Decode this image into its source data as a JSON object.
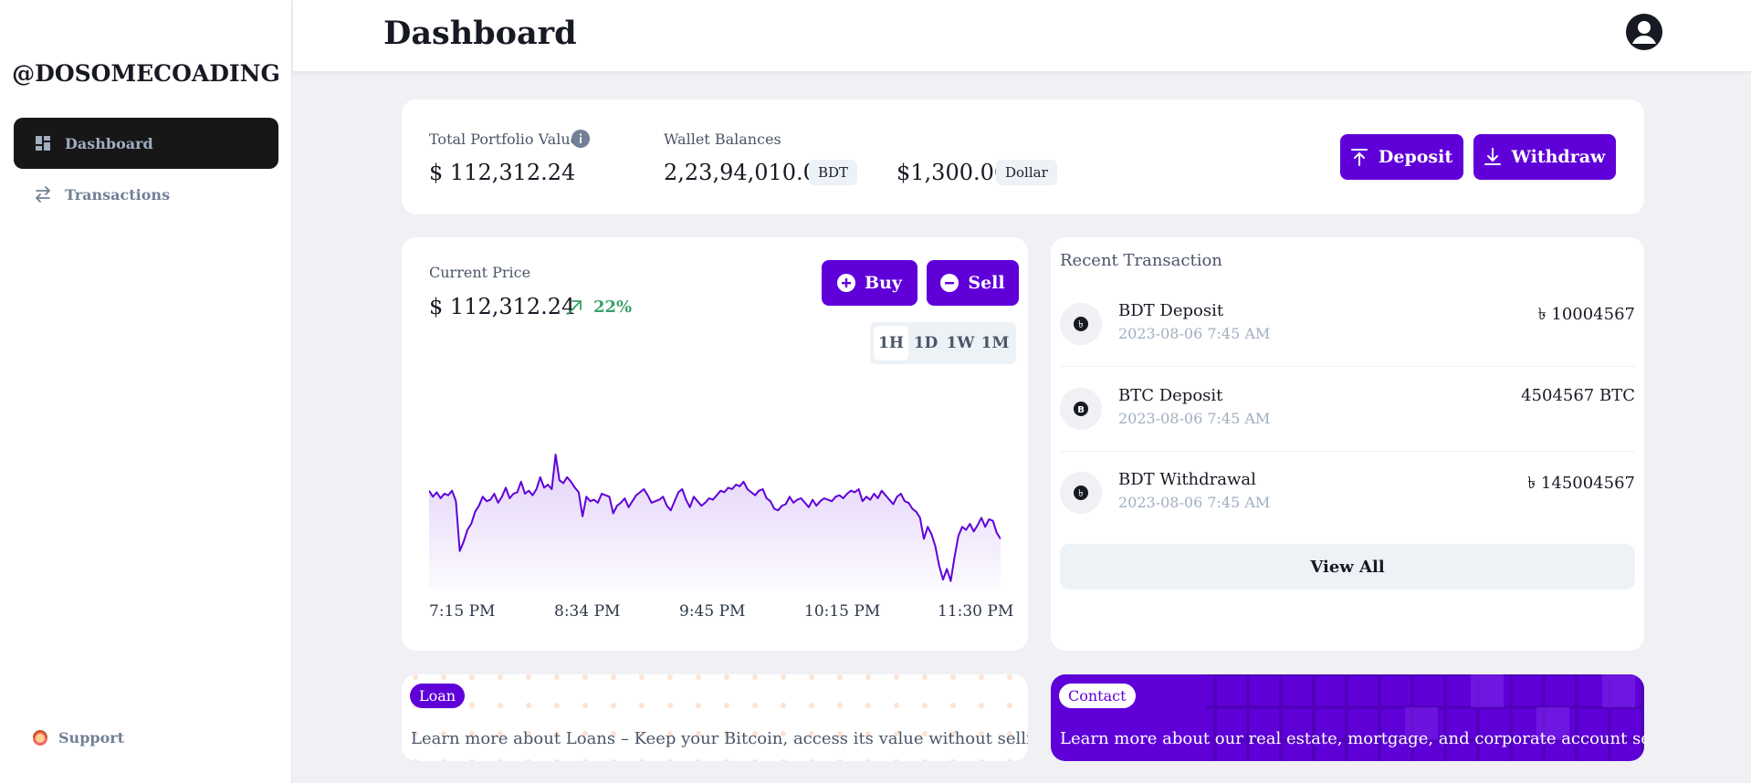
{
  "sidebar": {
    "brand": "@DOSOMECOADING",
    "items": [
      {
        "label": "Dashboard",
        "icon": "dashboard-icon",
        "active": true
      },
      {
        "label": "Transactions",
        "icon": "transfer-arrows-icon",
        "active": false
      }
    ],
    "support_label": "Support",
    "support_icon": "support-agent-icon"
  },
  "header": {
    "title": "Dashboard",
    "avatar_icon": "user-circle-icon"
  },
  "portfolio": {
    "total_label": "Total Portfolio Value",
    "total_value": "$ 112,312.24",
    "wallet_label": "Wallet Balances",
    "balances": [
      {
        "value": "2,23,94,010.00",
        "currency": "BDT"
      },
      {
        "value": "$1,300.00",
        "currency": "Dollar"
      }
    ],
    "deposit_label": "Deposit",
    "withdraw_label": "Withdraw"
  },
  "price": {
    "label": "Current Price",
    "value": "$ 112,312.24",
    "change": "22%",
    "buy_label": "Buy",
    "sell_label": "Sell",
    "ranges": [
      "1H",
      "1D",
      "1W",
      "1M"
    ],
    "active_range": "1H"
  },
  "chart_data": {
    "type": "area",
    "x_ticks": [
      "7:15 PM",
      "8:34 PM",
      "9:45 PM",
      "10:15 PM",
      "11:30 PM"
    ],
    "values": [
      62,
      58,
      61,
      57,
      60,
      59,
      62,
      55,
      22,
      28,
      36,
      40,
      48,
      52,
      58,
      55,
      56,
      60,
      54,
      58,
      64,
      57,
      60,
      61,
      68,
      60,
      62,
      59,
      63,
      71,
      64,
      66,
      63,
      86,
      69,
      67,
      71,
      68,
      64,
      61,
      45,
      58,
      55,
      56,
      54,
      60,
      59,
      58,
      47,
      52,
      54,
      57,
      51,
      55,
      59,
      61,
      63,
      59,
      54,
      55,
      56,
      58,
      52,
      49,
      55,
      61,
      63,
      56,
      51,
      58,
      55,
      52,
      54,
      57,
      56,
      59,
      62,
      61,
      64,
      63,
      66,
      65,
      68,
      63,
      61,
      59,
      62,
      63,
      57,
      55,
      50,
      49,
      52,
      53,
      58,
      54,
      56,
      57,
      54,
      51,
      56,
      52,
      55,
      57,
      56,
      55,
      58,
      59,
      57,
      60,
      62,
      61,
      63,
      55,
      58,
      56,
      60,
      57,
      62,
      59,
      56,
      53,
      58,
      60,
      55,
      54,
      50,
      48,
      44,
      30,
      38,
      33,
      25,
      12,
      3,
      10,
      2,
      18,
      32,
      38,
      36,
      40,
      35,
      39,
      44,
      38,
      43,
      42,
      34,
      30
    ],
    "series_color": "#5f00d9"
  },
  "transactions": {
    "title": "Recent Transaction",
    "items": [
      {
        "name": "BDT Deposit",
        "date": "2023-08-06 7:45 AM",
        "amount": "৳ 10004567",
        "icon": "taka-coin-icon"
      },
      {
        "name": "BTC Deposit",
        "date": "2023-08-06 7:45 AM",
        "amount": "4504567 BTC",
        "icon": "bitcoin-coin-icon"
      },
      {
        "name": "BDT Withdrawal",
        "date": "2023-08-06 7:45 AM",
        "amount": "৳ 145004567",
        "icon": "taka-coin-icon"
      }
    ],
    "view_all_label": "View All"
  },
  "promos": {
    "loan_tag": "Loan",
    "loan_text": "Learn more about Loans – Keep your Bitcoin, access its value without selling it",
    "contact_tag": "Contact",
    "contact_text": "Learn more about our real estate, mortgage, and corporate account services"
  },
  "colors": {
    "accent": "#5f00d9",
    "sidebar_active": "#171717",
    "positive": "#38a169"
  }
}
